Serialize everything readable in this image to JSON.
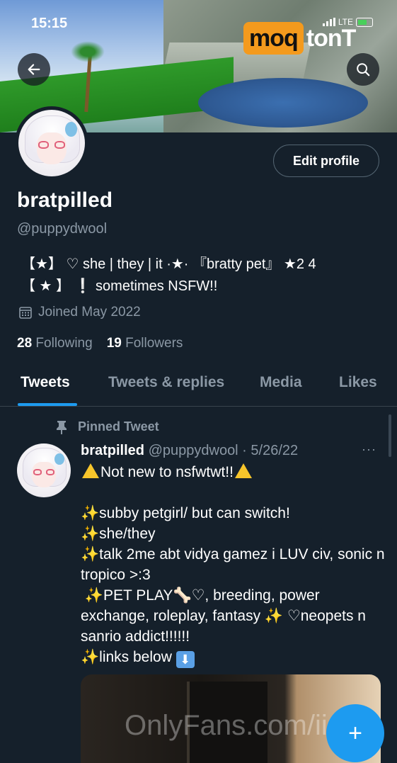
{
  "status_bar": {
    "time": "15:15",
    "network": "LTE"
  },
  "watermark": {
    "part1": "moq",
    "part2": "tonT"
  },
  "profile": {
    "display_name": "bratpilled",
    "handle": "@puppydwool",
    "edit_label": "Edit profile",
    "bio_line1": "【★】 ♡ she | they | it ·★· 『bratty pet』 ★2 4",
    "bio_line2": "【 ★ 】 ❕ sometimes NSFW!!",
    "joined": "Joined May 2022",
    "following_count": "28",
    "following_label": "Following",
    "followers_count": "19",
    "followers_label": "Followers"
  },
  "tabs": [
    {
      "label": "Tweets"
    },
    {
      "label": "Tweets & replies"
    },
    {
      "label": "Media"
    },
    {
      "label": "Likes"
    }
  ],
  "pinned_tweet": {
    "pinned_label": "Pinned Tweet",
    "name": "bratpilled",
    "handle_date": "@puppydwool · 5/26/22",
    "more": "···",
    "line1": "Not new to nsfwtwt!!",
    "line2": "subby petgirl/ but can switch!",
    "line3": "she/they",
    "line4": "talk 2me abt vidya gamez i LUV civ, sonic n tropico >:3",
    "line5": "PET PLAY🦴♡, breeding, power exchange, roleplay, fantasy ✨ ♡neopets n sanrio addict!!!!!!",
    "line6": "links below"
  },
  "overlay": {
    "onlyfans_watermark": "OnlyFans.com/iiuwu"
  },
  "fab": {
    "label": "+"
  },
  "colors": {
    "background": "#15202b",
    "accent": "#1d9bf0",
    "muted": "#8b98a5"
  }
}
